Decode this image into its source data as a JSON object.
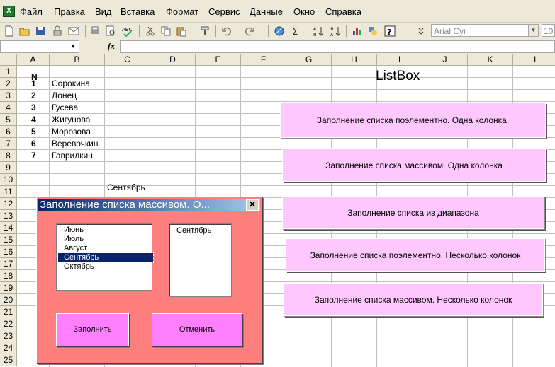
{
  "menu": {
    "items": [
      {
        "pre": "",
        "u": "Ф",
        "post": "айл"
      },
      {
        "pre": "",
        "u": "П",
        "post": "равка"
      },
      {
        "pre": "",
        "u": "В",
        "post": "ид"
      },
      {
        "pre": "Вст",
        "u": "а",
        "post": "вка"
      },
      {
        "pre": "Фор",
        "u": "м",
        "post": "ат"
      },
      {
        "pre": "",
        "u": "С",
        "post": "ервис"
      },
      {
        "pre": "",
        "u": "Д",
        "post": "анные"
      },
      {
        "pre": "",
        "u": "О",
        "post": "кно"
      },
      {
        "pre": "",
        "u": "С",
        "post": "правка"
      }
    ]
  },
  "toolbar": {
    "font_name": "Arial Cyr",
    "font_size": "10"
  },
  "formula_bar": {
    "fx_label": "fx"
  },
  "grid": {
    "columns": [
      "A",
      "B",
      "C",
      "D",
      "E",
      "F",
      "G",
      "H",
      "I",
      "J",
      "K",
      "L"
    ],
    "rows": [
      "1",
      "2",
      "3",
      "4",
      "5",
      "6",
      "7",
      "8",
      "9",
      "10",
      "11",
      "12",
      "13",
      "14",
      "15",
      "16",
      "17",
      "18",
      "19",
      "20",
      "21",
      "22",
      "23",
      "24",
      "25"
    ],
    "header_n": "N",
    "numbers": [
      "1",
      "2",
      "3",
      "4",
      "5",
      "6",
      "7"
    ],
    "names": [
      "Сорокина",
      "Донец",
      "Гусева",
      "Жигунова",
      "Морозова",
      "Веревочкин",
      "Гаврилкин"
    ],
    "c10": "Сентябрь",
    "listbox_title": "ListBox"
  },
  "sheet_buttons": [
    "Заполнение списка поэлементно. Одна колонка.",
    "Заполнение списка массивом. Одна колонка",
    "Заполнение списка из диапазона",
    "Заполнение списка поэлементно. Несколько колонок",
    "Заполнение списка массивом. Несколько колонок"
  ],
  "userform": {
    "title": "Заполнение списка массивом. О...",
    "close": "✕",
    "listbox_items": [
      "Июнь",
      "Июль",
      "Август",
      "Сентябрь",
      "Октябрь"
    ],
    "selected_item": "Сентябрь",
    "listbox2_items": [
      "Сентябрь"
    ],
    "fill_button": "Заполнить",
    "cancel_button": "Отменить"
  }
}
